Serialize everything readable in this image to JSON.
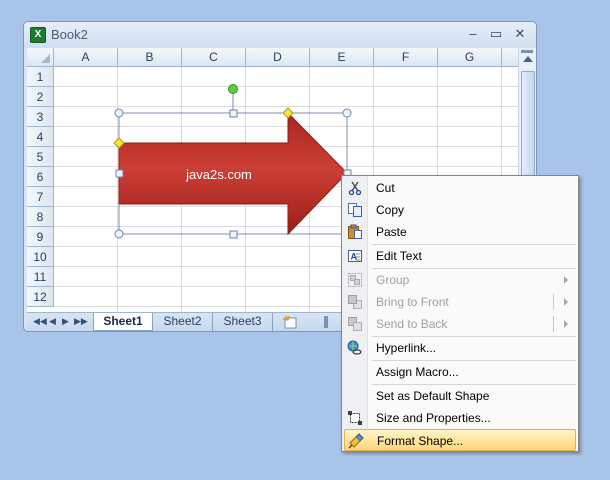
{
  "window": {
    "title": "Book2",
    "app_icon": "X",
    "controls": {
      "minimize": "–",
      "maximize": "▭",
      "close": "✕"
    }
  },
  "sheet": {
    "columns": [
      "A",
      "B",
      "C",
      "D",
      "E",
      "F",
      "G"
    ],
    "rows": [
      "1",
      "2",
      "3",
      "4",
      "5",
      "6",
      "7",
      "8",
      "9",
      "10",
      "11",
      "12"
    ]
  },
  "shape": {
    "text": "java2s.com",
    "fill": "#c0302b",
    "outline": "#8c1a16"
  },
  "tabs": {
    "nav": [
      "◀◀",
      "◀",
      "▶",
      "▶▶"
    ],
    "sheets": [
      "Sheet1",
      "Sheet2",
      "Sheet3"
    ],
    "active": "Sheet1"
  },
  "context_menu": {
    "items": [
      {
        "label": "Cut",
        "icon": "scissors-icon",
        "enabled": true
      },
      {
        "label": "Copy",
        "icon": "copy-icon",
        "enabled": true
      },
      {
        "label": "Paste",
        "icon": "paste-icon",
        "enabled": true
      },
      {
        "label": "Edit Text",
        "icon": "edit-text-icon",
        "enabled": true
      },
      {
        "label": "Group",
        "icon": "group-icon",
        "enabled": false,
        "submenu": true
      },
      {
        "label": "Bring to Front",
        "icon": "bring-to-front-icon",
        "enabled": false,
        "submenu": true
      },
      {
        "label": "Send to Back",
        "icon": "send-to-back-icon",
        "enabled": false,
        "submenu": true
      },
      {
        "label": "Hyperlink...",
        "icon": "hyperlink-icon",
        "enabled": true
      },
      {
        "label": "Assign Macro...",
        "icon": "",
        "enabled": true
      },
      {
        "label": "Set as Default Shape",
        "icon": "",
        "enabled": true
      },
      {
        "label": "Size and Properties...",
        "icon": "size-properties-icon",
        "enabled": true
      },
      {
        "label": "Format Shape...",
        "icon": "format-shape-icon",
        "enabled": true,
        "hover": true
      }
    ]
  }
}
